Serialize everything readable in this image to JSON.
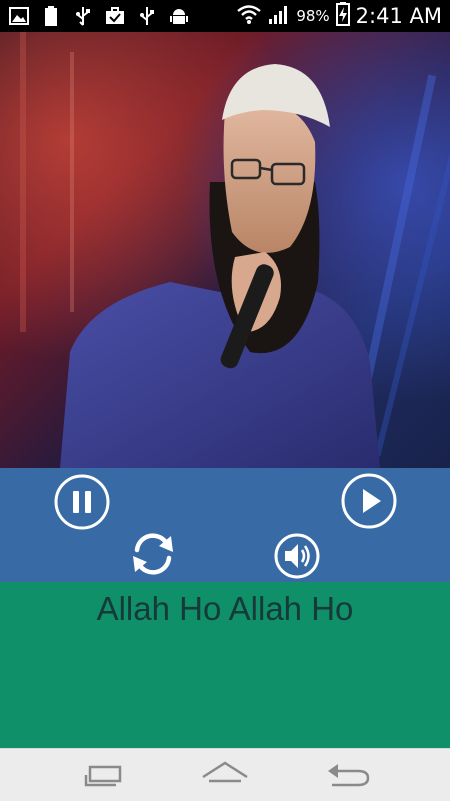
{
  "status_bar": {
    "battery_percent": "98%",
    "time": "2:41 AM",
    "icons": [
      "image-icon",
      "battery-full-icon",
      "usb-icon",
      "usb-icon",
      "android-icon",
      "wifi-icon",
      "signal-icon",
      "battery-charging-icon"
    ]
  },
  "player": {
    "track_title": "Allah Ho Allah Ho",
    "album_art": "singer-performance-photo",
    "colors": {
      "controls_bg": "#386ba6",
      "lyrics_bg": "#0f9068",
      "title_color": "#163a3a",
      "nav_bg": "#ececec"
    }
  },
  "nav_bar": {
    "buttons": [
      "recent-apps-icon",
      "home-icon",
      "back-icon"
    ]
  }
}
